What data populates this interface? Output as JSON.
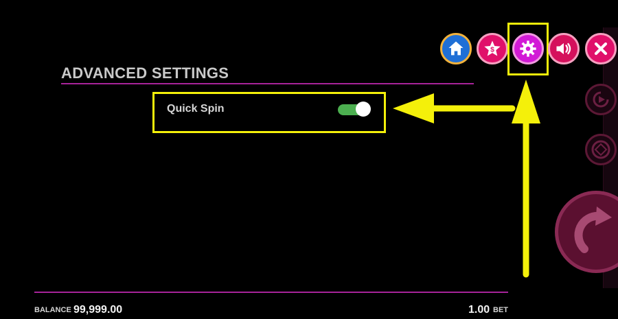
{
  "settings": {
    "title": "ADVANCED SETTINGS",
    "quick_spin": {
      "label": "Quick Spin",
      "enabled": true
    }
  },
  "toolbar": {
    "icons": [
      "home-icon",
      "star-dollar-icon",
      "gear-icon",
      "speaker-icon",
      "close-icon"
    ]
  },
  "footer": {
    "balance_label": "BALANCE",
    "balance_value": "99,999.00",
    "bet_value": "1.00",
    "bet_label": "BET"
  },
  "colors": {
    "background": "#000000",
    "accent_rule": "#a8239a",
    "highlight": "#f4f00a",
    "toggle_on": "#4caf50"
  }
}
